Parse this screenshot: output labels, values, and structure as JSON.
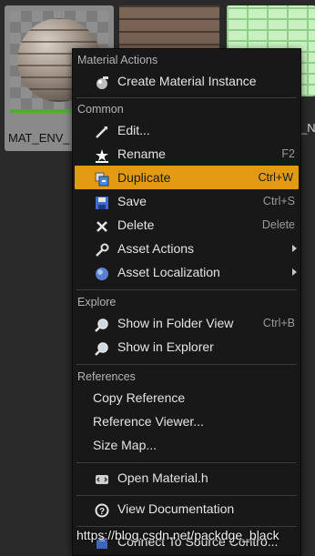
{
  "assets": {
    "selected_name": "MAT_ENV_",
    "right_name": "_N"
  },
  "menu": {
    "sections": {
      "material_actions": "Material Actions",
      "common": "Common",
      "explore": "Explore",
      "references": "References"
    },
    "items": {
      "create_material_instance": {
        "label": "Create Material Instance",
        "icon": "material-instance-icon"
      },
      "edit": {
        "label": "Edit...",
        "icon": "edit-icon"
      },
      "rename": {
        "label": "Rename",
        "shortcut": "F2",
        "icon": "rename-icon"
      },
      "duplicate": {
        "label": "Duplicate",
        "shortcut": "Ctrl+W",
        "icon": "duplicate-icon"
      },
      "save": {
        "label": "Save",
        "shortcut": "Ctrl+S",
        "icon": "save-icon"
      },
      "delete": {
        "label": "Delete",
        "shortcut": "Delete",
        "icon": "delete-icon"
      },
      "asset_actions": {
        "label": "Asset Actions",
        "icon": "wrench-icon"
      },
      "asset_localization": {
        "label": "Asset Localization",
        "icon": "globe-icon"
      },
      "show_in_folder_view": {
        "label": "Show in Folder View",
        "shortcut": "Ctrl+B",
        "icon": "magnifier-icon"
      },
      "show_in_explorer": {
        "label": "Show in Explorer",
        "icon": "magnifier-icon"
      },
      "copy_reference": {
        "label": "Copy Reference"
      },
      "reference_viewer": {
        "label": "Reference Viewer..."
      },
      "size_map": {
        "label": "Size Map..."
      },
      "open_material_h": {
        "label": "Open Material.h",
        "icon": "code-icon"
      },
      "view_documentation": {
        "label": "View Documentation",
        "icon": "help-icon"
      },
      "connect_source_control": {
        "label": "Connect To Source Contro...",
        "icon": "source-control-icon"
      }
    },
    "highlight_color": "#e29a12"
  },
  "watermark": "https://blog.csdn.net/packdge_black"
}
